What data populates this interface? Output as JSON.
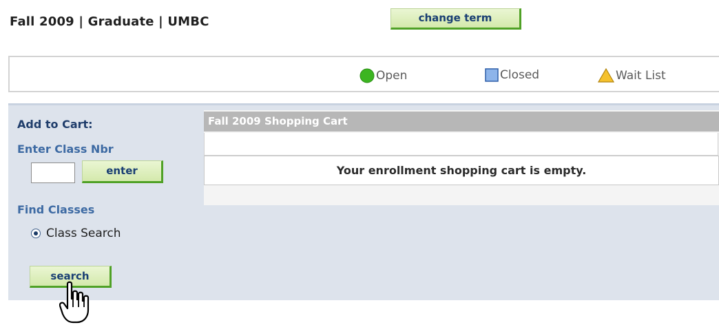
{
  "header": {
    "term_title": "Fall 2009 | Graduate | UMBC",
    "change_term_label": "change term"
  },
  "legend": {
    "open": "Open",
    "closed": "Closed",
    "wait_list": "Wait List",
    "colors": {
      "open": "#3cb521",
      "closed": "#6f9be0",
      "wait_list": "#f5c12c"
    }
  },
  "sidebar": {
    "add_to_cart": "Add to Cart:",
    "enter_class_nbr": "Enter Class Nbr",
    "class_nbr_value": "",
    "enter_label": "enter",
    "find_classes": "Find Classes",
    "class_search_option": "Class Search",
    "search_label": "search"
  },
  "cart": {
    "title": "Fall 2009 Shopping Cart",
    "empty_message": "Your enrollment shopping cart is empty."
  },
  "icons": {
    "open": "green-circle-icon",
    "closed": "blue-square-icon",
    "wait_list": "warning-triangle-icon",
    "cursor": "hand-pointer-icon"
  }
}
